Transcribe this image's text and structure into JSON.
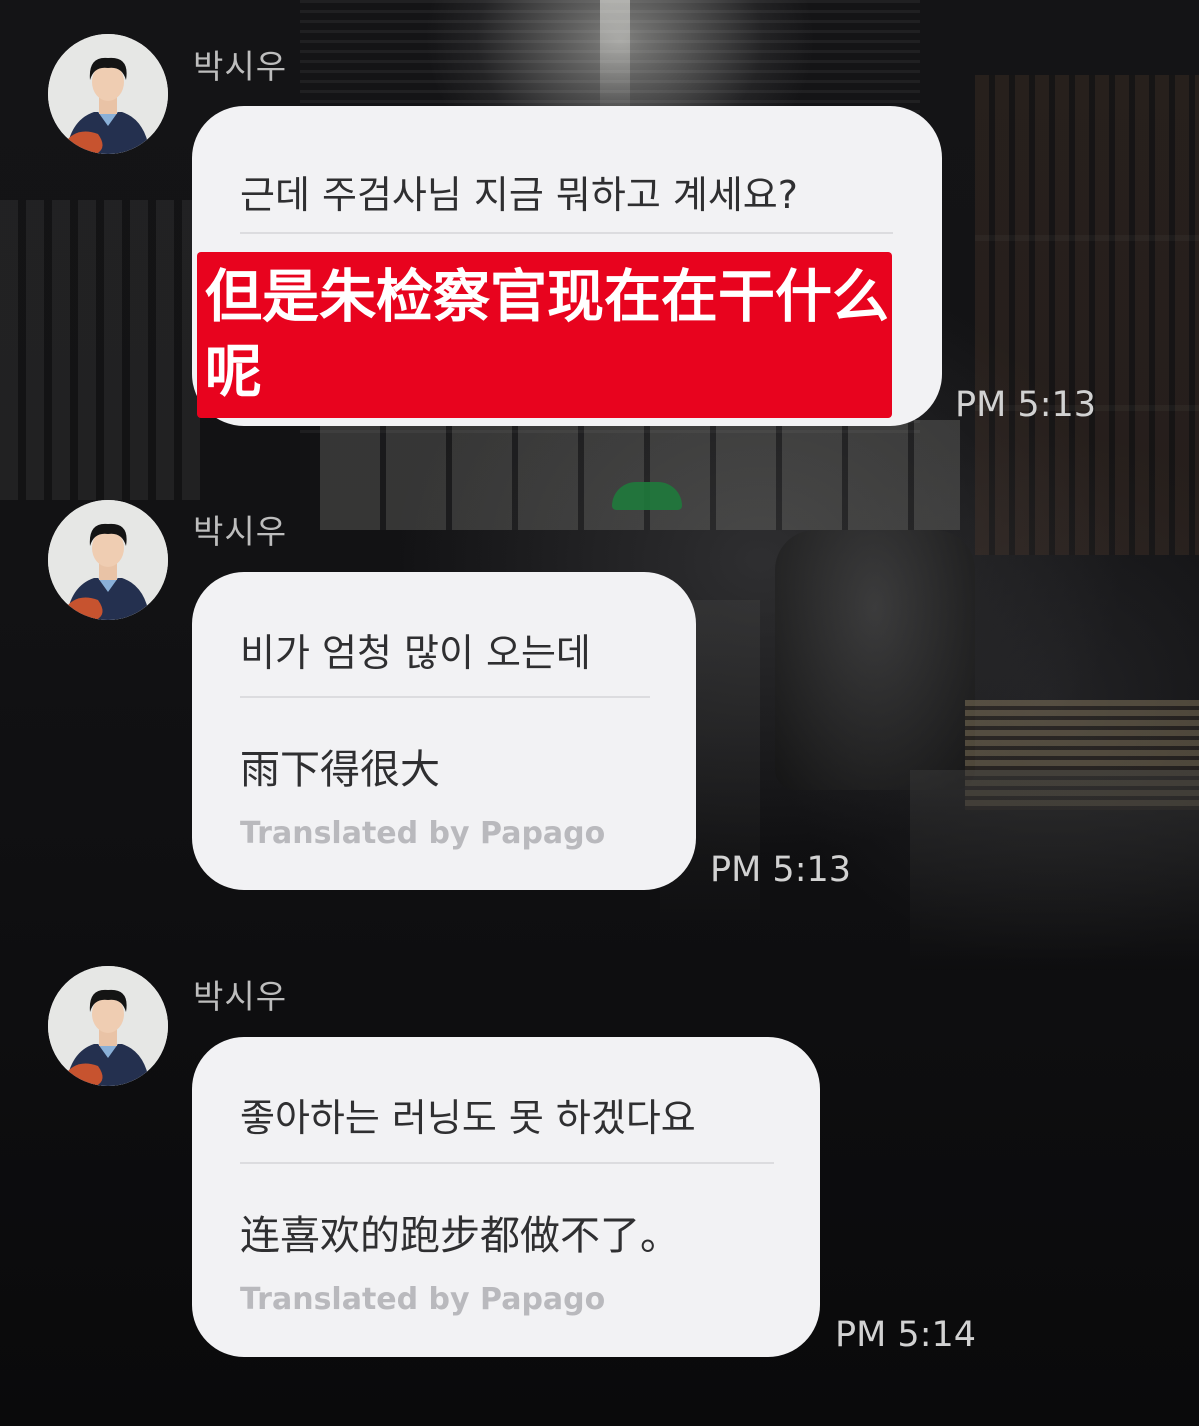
{
  "sender_name": "박시우",
  "translator_note": "Translated by Papago",
  "messages": [
    {
      "original": "근데 주검사님 지금 뭐하고 계세요?",
      "translation_highlighted": "但是朱检察官现在在干什么呢",
      "highlight_color": "#e8031e",
      "time": "PM 5:13"
    },
    {
      "original": "비가 엄청 많이 오는데",
      "translation": "雨下得很大",
      "time": "PM 5:13"
    },
    {
      "original": "좋아하는 러닝도 못 하겠다요",
      "translation": "连喜欢的跑步都做不了。",
      "time": "PM 5:14"
    }
  ],
  "colors": {
    "bubble": "#f2f2f4",
    "text": "#2f2f31",
    "muted": "#b9b9bd",
    "timestamp": "#d2d2d2"
  }
}
